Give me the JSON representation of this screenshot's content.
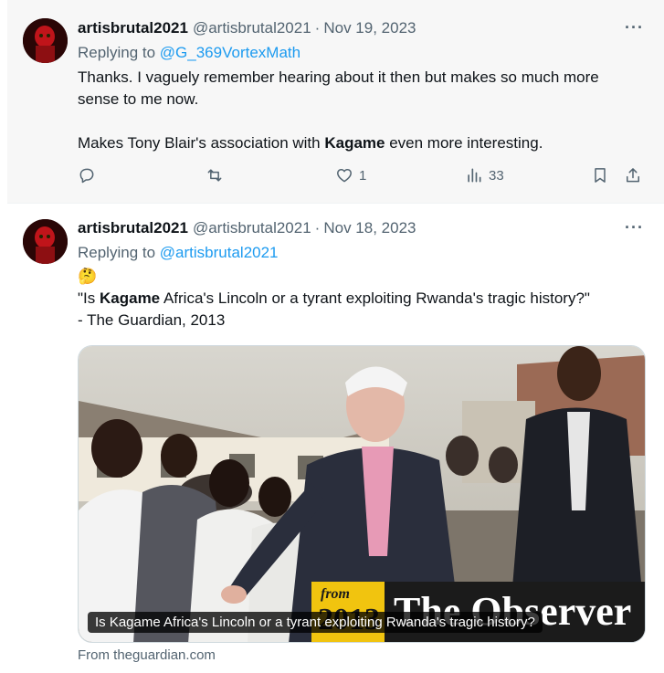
{
  "tweets": [
    {
      "name": "artisbrutal2021",
      "handle": "@artisbrutal2021",
      "dot": "·",
      "date": "Nov 19, 2023",
      "replying_prefix": "Replying to",
      "replying_to": "@G_369VortexMath",
      "lines": [
        "Thanks. I vaguely remember hearing about it then but makes so much more",
        "sense to me now."
      ],
      "line3_prefix": "Makes Tony Blair's association with",
      "line3_bold": "Kagame",
      "line3_suffix": "even more interesting.",
      "actions": {
        "replies": "",
        "reposts": "",
        "likes": "1",
        "views": "33"
      }
    },
    {
      "name": "artisbrutal2021",
      "handle": "@artisbrutal2021",
      "dot": "·",
      "date": "Nov 18, 2023",
      "replying_prefix": "Replying to",
      "replying_to": "@artisbrutal2021",
      "emoji": "🤔",
      "quote_prefix": "\"Is",
      "quote_bold": "Kagame",
      "quote_suffix": "Africa's Lincoln or a tyrant exploiting Rwanda's tragic history?\"",
      "quote_source": "- The Guardian, 2013",
      "card": {
        "caption": "Is Kagame Africa's Lincoln or a tyrant exploiting Rwanda's tragic history?",
        "logo_from": "from",
        "logo_year": "2013",
        "logo_name": "The Observer",
        "source": "From theguardian.com"
      }
    }
  ],
  "more_label": "···"
}
